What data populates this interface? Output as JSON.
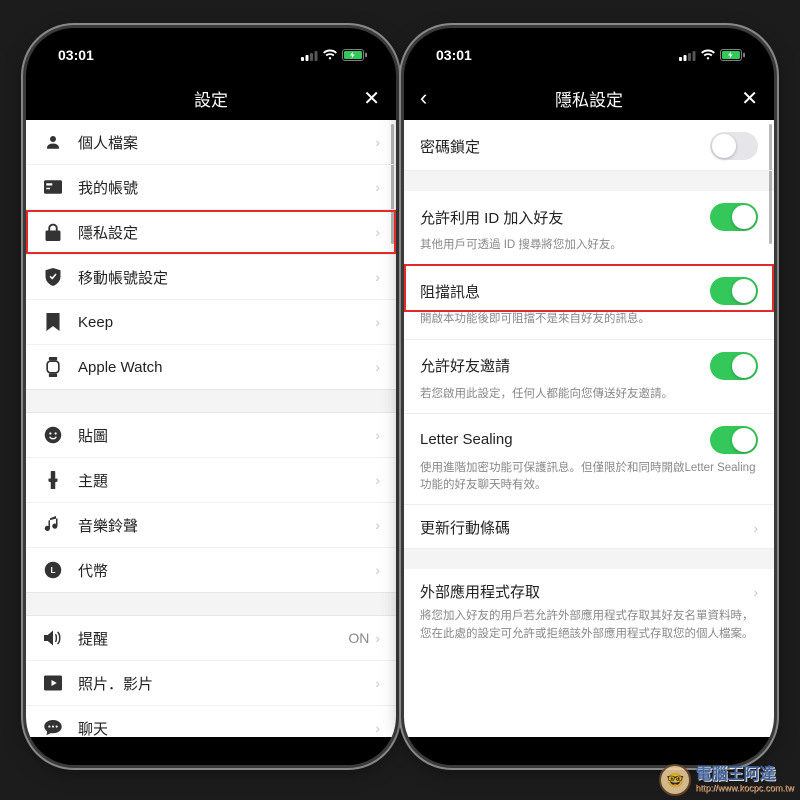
{
  "status": {
    "time": "03:01"
  },
  "left": {
    "title": "設定",
    "groups": [
      {
        "items": [
          {
            "icon": "user-icon",
            "label": "個人檔案"
          },
          {
            "icon": "card-icon",
            "label": "我的帳號"
          },
          {
            "icon": "lock-icon",
            "label": "隱私設定",
            "highlight": true
          },
          {
            "icon": "shield-icon",
            "label": "移動帳號設定"
          },
          {
            "icon": "bookmark-icon",
            "label": "Keep"
          },
          {
            "icon": "watch-icon",
            "label": "Apple Watch"
          }
        ]
      },
      {
        "items": [
          {
            "icon": "smiley-icon",
            "label": "貼圖"
          },
          {
            "icon": "brush-icon",
            "label": "主題"
          },
          {
            "icon": "music-icon",
            "label": "音樂鈴聲"
          },
          {
            "icon": "coin-icon",
            "label": "代幣"
          }
        ]
      },
      {
        "items": [
          {
            "icon": "speaker-icon",
            "label": "提醒",
            "value": "ON"
          },
          {
            "icon": "photo-icon",
            "label": "照片．影片"
          },
          {
            "icon": "chat-icon",
            "label": "聊天"
          }
        ]
      }
    ]
  },
  "right": {
    "title": "隱私設定",
    "rows": [
      {
        "label": "密碼鎖定",
        "toggle": false
      },
      {
        "sep": true
      },
      {
        "label": "允許利用 ID 加入好友",
        "toggle": true,
        "desc": "其他用戶可透過 ID 搜尋將您加入好友。"
      },
      {
        "label": "阻擋訊息",
        "toggle": true,
        "desc": "開啟本功能後即可阻擋不是來自好友的訊息。",
        "highlight": true
      },
      {
        "label": "允許好友邀請",
        "toggle": true,
        "desc": "若您啟用此設定，任何人都能向您傳送好友邀請。"
      },
      {
        "label": "Letter Sealing",
        "toggle": true,
        "desc": "使用進階加密功能可保護訊息。但僅限於和同時開啟Letter Sealing功能的好友聊天時有效。"
      },
      {
        "label": "更新行動條碼",
        "nav": true
      },
      {
        "sep": true
      },
      {
        "label": "外部應用程式存取",
        "nav": true,
        "desc": "將您加入好友的用戶若允許外部應用程式存取其好友名單資料時，您在此處的設定可允許或拒絕該外部應用程式存取您的個人檔案。"
      }
    ]
  },
  "watermark": {
    "text": "電腦王阿達",
    "url": "http://www.kocpc.com.tw"
  }
}
